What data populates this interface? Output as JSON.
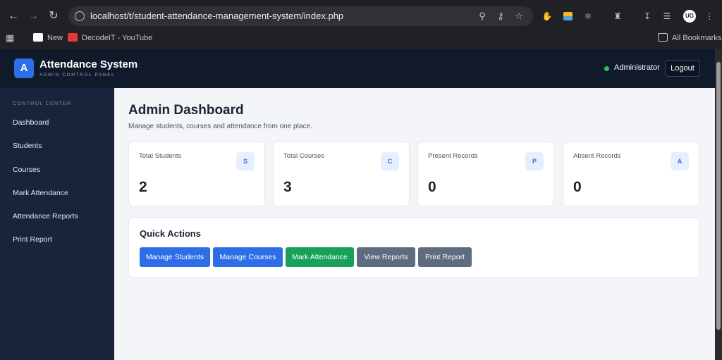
{
  "browser": {
    "url": "localhost/t/student-attendance-management-system/index.php",
    "bookmarks": [
      {
        "label": "New",
        "icon": "uc-icon"
      },
      {
        "label": "DecodeIT - YouTube",
        "icon": "youtube-icon"
      }
    ],
    "all_bookmarks": "All Bookmarks",
    "avatar_initials": "UG"
  },
  "header": {
    "logo_letter": "A",
    "title": "Attendance System",
    "subtitle": "ADMIN CONTROL PANEL",
    "user_label": "Administrator",
    "logout_label": "Logout",
    "status_color": "#22c55e"
  },
  "sidebar": {
    "section_title": "CONTROL CENTER",
    "items": [
      {
        "label": "Dashboard"
      },
      {
        "label": "Students"
      },
      {
        "label": "Courses"
      },
      {
        "label": "Mark Attendance"
      },
      {
        "label": "Attendance Reports"
      },
      {
        "label": "Print Report"
      }
    ]
  },
  "main": {
    "title": "Admin Dashboard",
    "subtitle": "Manage students, courses and attendance from one place.",
    "cards": [
      {
        "label": "Total Students",
        "badge": "S",
        "value": "2"
      },
      {
        "label": "Total Courses",
        "badge": "C",
        "value": "3"
      },
      {
        "label": "Present Records",
        "badge": "P",
        "value": "0"
      },
      {
        "label": "Absent Records",
        "badge": "A",
        "value": "0"
      }
    ],
    "quick_actions": {
      "title": "Quick Actions",
      "buttons": [
        {
          "label": "Manage Students",
          "color": "#2d6ee8"
        },
        {
          "label": "Manage Courses",
          "color": "#2d6ee8"
        },
        {
          "label": "Mark Attendance",
          "color": "#16a05a"
        },
        {
          "label": "View Reports",
          "color": "#5f6b7e"
        },
        {
          "label": "Print Report",
          "color": "#5f6b7e"
        }
      ]
    }
  }
}
